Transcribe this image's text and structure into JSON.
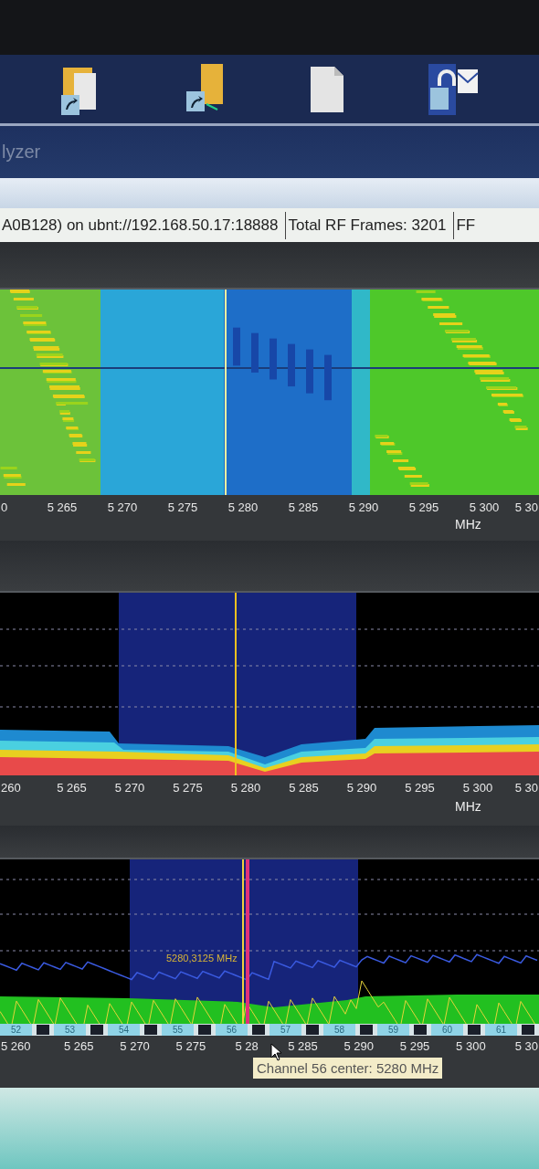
{
  "window": {
    "title": "lyzer"
  },
  "status_bar": [
    "A0B128) on ubnt://192.168.50.17:18888",
    "Total RF Frames: 3201",
    "FF"
  ],
  "charts": [
    {
      "kind": "waterfall",
      "ticks": [
        "0",
        "5 265",
        "5 270",
        "5 275",
        "5 280",
        "5 285",
        "5 290",
        "5 295",
        "5 300",
        "5 30"
      ],
      "unit": "MHz"
    },
    {
      "kind": "density",
      "ticks": [
        "260",
        "5 265",
        "5 270",
        "5 275",
        "5 280",
        "5 285",
        "5 290",
        "5 295",
        "5 300",
        "5 30"
      ],
      "unit": "MHz"
    },
    {
      "kind": "trace",
      "ticks": [
        "5 260",
        "5 265",
        "5 270",
        "5 275",
        "5 28",
        "5 285",
        "5 290",
        "5 295",
        "5 300",
        "5 30"
      ],
      "channels": [
        "52",
        "53",
        "54",
        "55",
        "56",
        "57",
        "58",
        "59",
        "60",
        "61"
      ],
      "marker_label": "5280,3125 MHz",
      "tooltip": "Channel 56 center: 5280 MHz"
    }
  ]
}
